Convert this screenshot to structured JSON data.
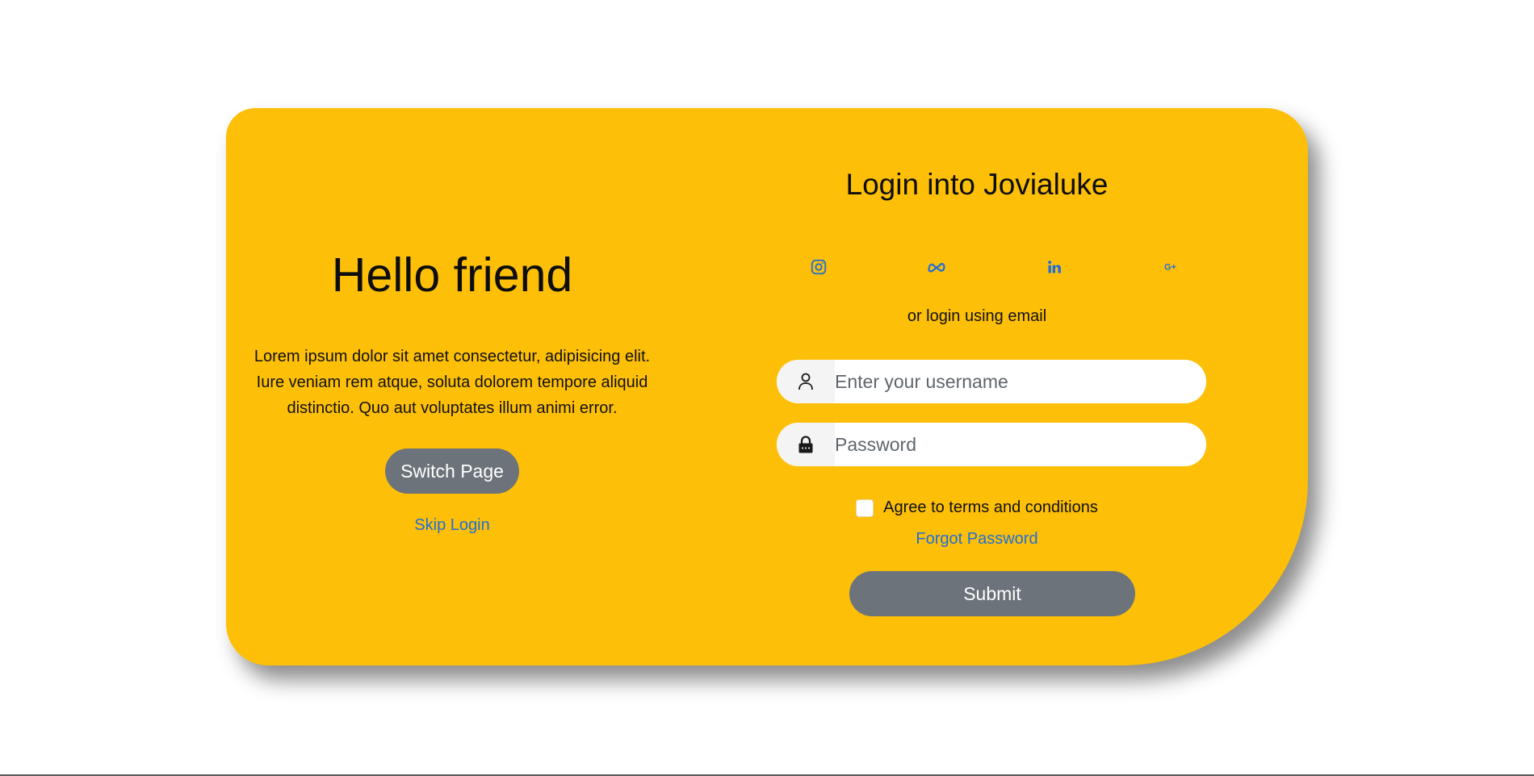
{
  "left_panel": {
    "heading": "Hello friend",
    "description": "Lorem ipsum dolor sit amet consectetur, adipisicing elit. Iure veniam rem atque, soluta dolorem tempore aliquid distinctio. Quo aut voluptates illum animi error.",
    "switch_button": "Switch Page",
    "skip_link": "Skip Login"
  },
  "right_panel": {
    "title": "Login into Jovialuke",
    "socials": [
      {
        "icon": "instagram-icon"
      },
      {
        "icon": "meta-icon"
      },
      {
        "icon": "linkedin-icon"
      },
      {
        "icon": "google-plus-icon"
      }
    ],
    "alt_login_text": "or login using email",
    "username": {
      "placeholder": "Enter your username",
      "value": "",
      "icon": "user-icon"
    },
    "password": {
      "placeholder": "Password",
      "value": "",
      "icon": "lock-icon"
    },
    "terms_label": "Agree to terms and conditions",
    "terms_checked": false,
    "forgot_link": "Forgot Password",
    "submit_button": "Submit"
  },
  "colors": {
    "card_background": "#fdbf07",
    "button_background": "#6c737a",
    "link_color": "#1f6fd8"
  }
}
